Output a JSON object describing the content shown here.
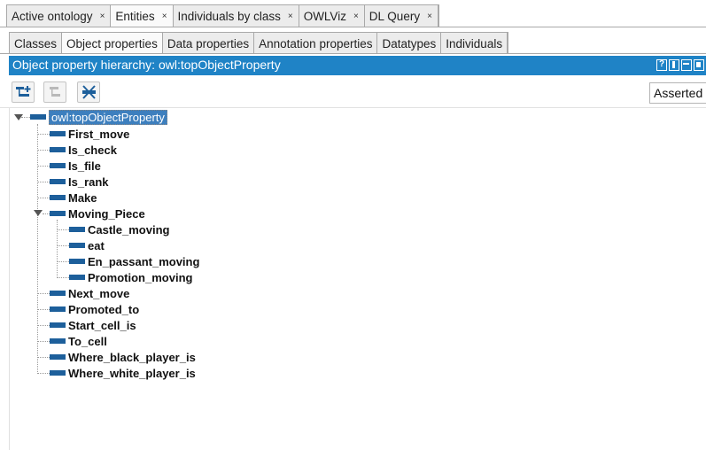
{
  "top_tabs": [
    {
      "label": "Active ontology",
      "close": "×"
    },
    {
      "label": "Entities",
      "close": "×"
    },
    {
      "label": "Individuals by class",
      "close": "×"
    },
    {
      "label": "OWLViz",
      "close": "×"
    },
    {
      "label": "DL Query",
      "close": "×"
    }
  ],
  "sub_tabs": [
    "Classes",
    "Object properties",
    "Data properties",
    "Annotation properties",
    "Datatypes",
    "Individuals"
  ],
  "view": {
    "title": "Object property hierarchy: owl:topObjectProperty",
    "help_label": "?"
  },
  "toolbar": {
    "mode_select": "Asserted"
  },
  "tree": {
    "root": "owl:topObjectProperty",
    "children": [
      "First_move",
      "Is_check",
      "Is_file",
      "Is_rank",
      "Make",
      "Moving_Piece",
      "Next_move",
      "Promoted_to",
      "Start_cell_is",
      "To_cell",
      "Where_black_player_is",
      "Where_white_player_is"
    ],
    "moving_piece_children": [
      "Castle_moving",
      "eat",
      "En_passant_moving",
      "Promotion_moving"
    ]
  },
  "colors": {
    "header_blue": "#1f83c6",
    "property_icon": "#1d5f9b"
  },
  "icons": {
    "add_sub": "add-subproperty-icon",
    "add_sibling": "add-sibling-property-icon",
    "delete": "delete-property-icon"
  }
}
